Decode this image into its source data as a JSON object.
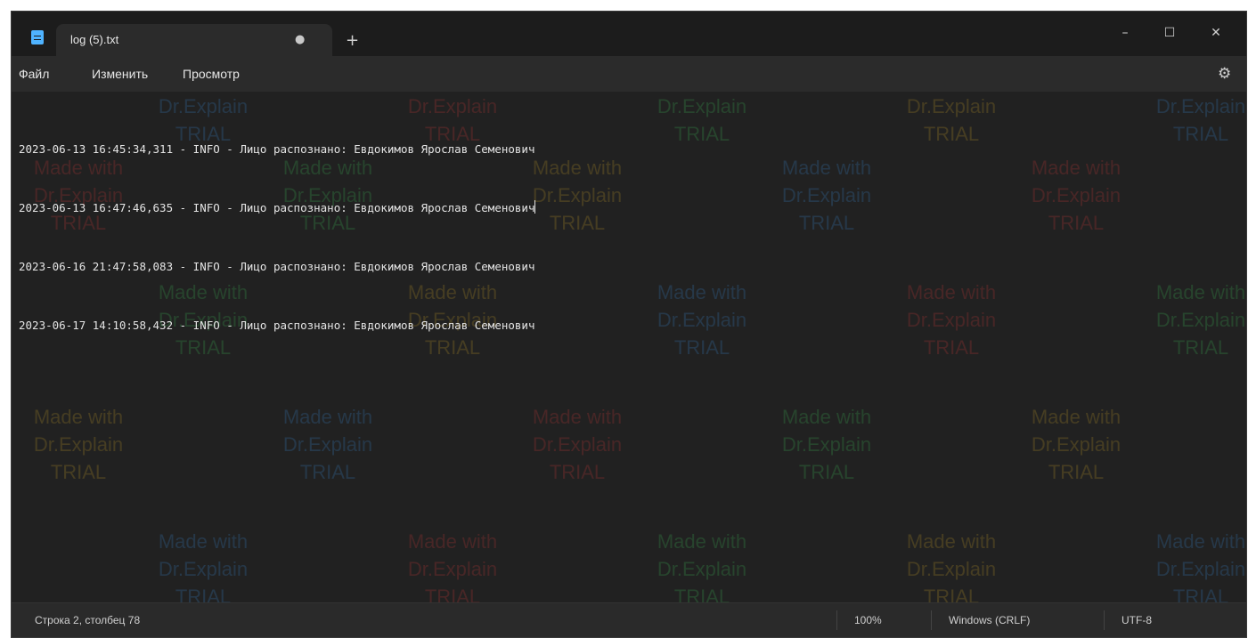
{
  "window": {
    "tab_title": "log (5).txt",
    "tab_modified_indicator": "●",
    "new_tab_label": "+",
    "minimize_label": "–",
    "maximize_label": "☐",
    "close_label": "✕"
  },
  "menu": {
    "items": [
      "Файл",
      "Изменить",
      "Просмотр"
    ],
    "settings_icon": "gear-icon"
  },
  "editor": {
    "lines": [
      "2023-06-13 16:45:34,311 - INFO - Лицо распознано: Евдокимов Ярослав Семенович",
      "2023-06-13 16:47:46,635 - INFO - Лицо распознано: Евдокимов Ярослав Семенович",
      "2023-06-16 21:47:58,083 - INFO - Лицо распознано: Евдокимов Ярослав Семенович",
      "2023-06-17 14:10:58,432 - INFO - Лицо распознано: Евдокимов Ярослав Семенович"
    ]
  },
  "watermark": {
    "line1": "Made with",
    "line2": "Dr.Explain",
    "line3": "TRIAL"
  },
  "status": {
    "position": "Строка 2, столбец 78",
    "zoom": "100%",
    "line_ending": "Windows (CRLF)",
    "encoding": "UTF-8"
  },
  "colors": {
    "background": "#212121",
    "text": "#e4e4e4",
    "accent_icon": "#4fb3ff",
    "watermark_palette": [
      "#3a8bd6",
      "#d23b3b",
      "#3fbf5a",
      "#c9a227"
    ]
  }
}
